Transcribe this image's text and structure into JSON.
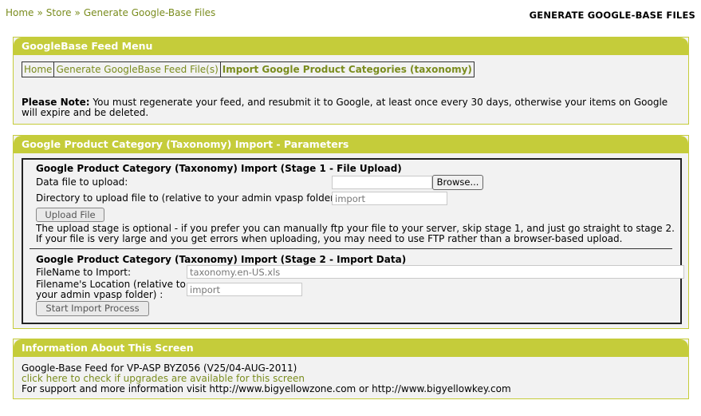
{
  "breadcrumb": [
    "Home",
    "Store",
    "Generate Google-Base Files"
  ],
  "breadcrumb_sep": "»",
  "page_title": "GENERATE GOOGLE-BASE FILES",
  "feed_menu": {
    "title": "GoogleBase Feed Menu",
    "tabs": [
      "Home",
      "Generate GoogleBase Feed File(s)",
      "Import Google Product Categories (taxonomy)"
    ],
    "note_label": "Please Note:",
    "note_text": " You must regenerate your feed, and resubmit it to Google, at least once every 30 days, otherwise your items on Google will expire and be deleted."
  },
  "import_params": {
    "title": "Google Product Category (Taxonomy) Import - Parameters",
    "stage1": {
      "title": "Google Product Category (Taxonomy) Import (Stage 1 - File Upload)",
      "file_label": "Data file to upload:",
      "browse_label": "Browse...",
      "dir_label": "Directory to upload file to (relative to your admin vpasp folder) :",
      "dir_value": "import",
      "upload_label": "Upload File",
      "help": "The upload stage is optional - if you prefer you can manually ftp your file to your server, skip stage 1, and just go straight to stage 2. If your file is very large and you get errors when uploading, you may need to use FTP rather than a browser-based upload."
    },
    "stage2": {
      "title": "Google Product Category (Taxonomy) Import (Stage 2 - Import Data)",
      "filename_label": "FileName to Import:",
      "filename_value": "taxonomy.en-US.xls",
      "location_label_1": "Filename's Location (relative to",
      "location_label_2": "your admin vpasp folder) :",
      "location_value": "import",
      "start_label": "Start Import Process"
    }
  },
  "info": {
    "title": "Information About This Screen",
    "line1": "Google-Base Feed for VP-ASP BYZ056 (V25/04-AUG-2011)",
    "link": "click here to check if upgrades are available for this screen",
    "line3": "For support and more information visit http://www.bigyellowzone.com or http://www.bigyellowkey.com"
  },
  "colors": {
    "accent": "#c5cc3a",
    "link": "#7a8c1e"
  }
}
